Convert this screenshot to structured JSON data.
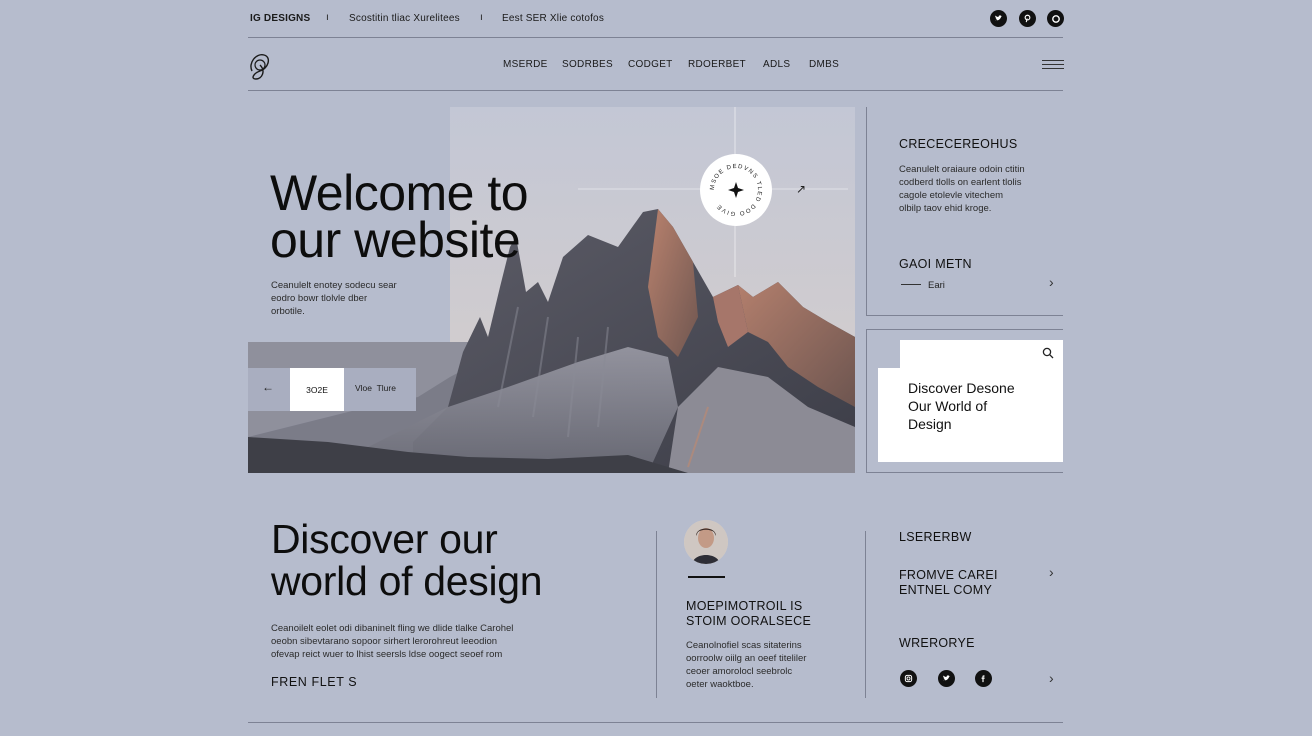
{
  "topbar": {
    "brand": "IG DESIGNS",
    "tagline": "Scostitin tliac Xurelitees",
    "info": "Eest SER Xlie cotofos",
    "social": [
      "twitter-icon",
      "pinterest-icon",
      "instagram-icon"
    ]
  },
  "nav": {
    "items": [
      "MSERDE",
      "SODRBES",
      "CODGET",
      "RDOERBET",
      "ADLS",
      "DMBS"
    ]
  },
  "hero": {
    "title_line1": "Welcome to",
    "title_line2": "our website",
    "text_line1": "Ceanulelt enotey sodecu sear",
    "text_line2": "eodro bowr tlolvle dber",
    "text_line3": "orbotile.",
    "prev": "←",
    "current": "3O2E",
    "next": "Vloe  Tlure"
  },
  "badge": {
    "ring_text": "MSOE DEDVNS TLED DOO GIVE"
  },
  "side": {
    "heading": "CRECECEREOHUS",
    "p1": "Ceanulelt oraiaure odoin ctitin",
    "p2": "codberd tlolls on earlent tlolis",
    "p3": "cagole etolevle vitechem",
    "p4": "olbilp taov ehid kroge.",
    "heading2": "GAOI METN",
    "sub": "Eari"
  },
  "card": {
    "line1": "Discover Desone",
    "line2": "Our World of",
    "line3": "Design"
  },
  "bottom": {
    "title_line1": "Discover our",
    "title_line2": "world of design",
    "p1": "Ceanoilelt eolet odi dibaninelt fling we dlide tlalke Carohel",
    "p2": "oeobn sibevtarano sopoor sirhert lerorohreut leeodion",
    "p3": "ofevap reict wuer to lhist seersls ldse oogect seoef rom",
    "link": "FREN FLET S"
  },
  "middle": {
    "heading1": "MOEPIMOTROIL IS",
    "heading2": "STOIM OORALSECE",
    "p1": "Ceanolnofiel scas sitaterins",
    "p2": "oorroolw oiilg an oeef titeliler",
    "p3": "ceoer amorolocl seebrolc",
    "p4": "oeter waoktboe."
  },
  "right": {
    "h1": "LSERERBW",
    "h2a": "FROMVE CAREI",
    "h2b": "ENTNEL COMY",
    "h3": "WRERORYE",
    "social": [
      "instagram-icon",
      "twitter-icon",
      "facebook-icon"
    ]
  }
}
